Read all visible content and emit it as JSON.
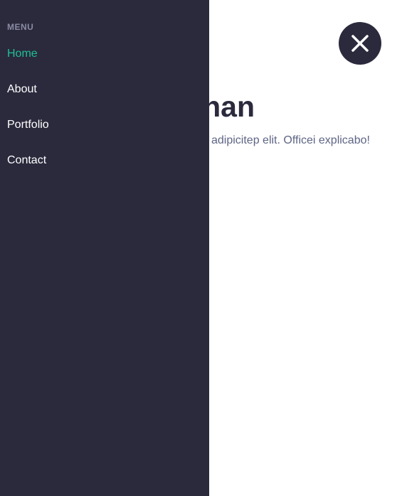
{
  "colors": {
    "sidebar_bg": "#2b2a3d",
    "accent": "#1fbf95",
    "text_dark": "#2b2a3d",
    "text_muted": "#5e6585",
    "menu_heading": "#8a8ba3",
    "nav_text": "#ffffff"
  },
  "sidebar": {
    "heading": "MENU",
    "items": [
      {
        "label": "Home",
        "active": true
      },
      {
        "label": "About",
        "active": false
      },
      {
        "label": "Portfolio",
        "active": false
      },
      {
        "label": "Contact",
        "active": false
      }
    ]
  },
  "main": {
    "title_visible": "nan",
    "text_visible": "adipicitep elit. Officei explicabo!"
  },
  "close_button": {
    "icon": "close-icon"
  }
}
